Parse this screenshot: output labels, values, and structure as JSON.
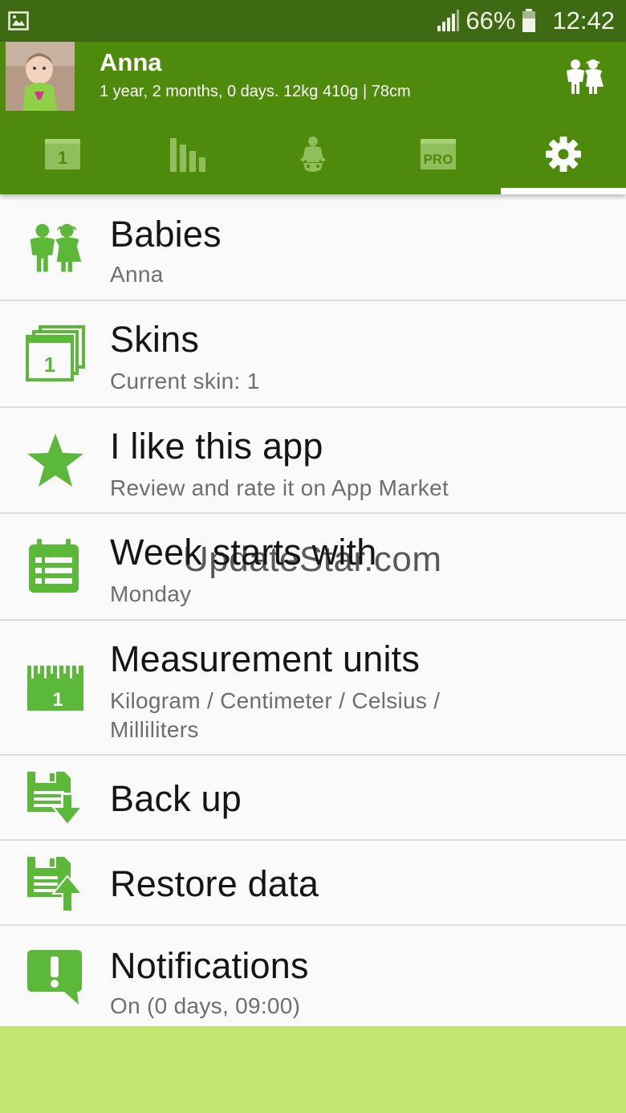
{
  "status_bar": {
    "battery_percent": "66%",
    "time": "12:42",
    "icons": [
      "gallery-notification-icon",
      "signal-icon",
      "battery-icon"
    ]
  },
  "header": {
    "baby_name": "Anna",
    "baby_info": "1 year, 2 months, 0 days. 12kg 410g | 78cm",
    "babies_icon": "children-icon"
  },
  "tabs": [
    {
      "id": "calendar",
      "icon": "calendar-day-icon",
      "number": "1",
      "selected": false
    },
    {
      "id": "charts",
      "icon": "bar-chart-icon",
      "selected": false
    },
    {
      "id": "diaper",
      "icon": "baby-diaper-icon",
      "selected": false
    },
    {
      "id": "pro",
      "icon": "pro-badge-icon",
      "badge": "PRO",
      "selected": false
    },
    {
      "id": "settings",
      "icon": "gear-icon",
      "selected": true
    }
  ],
  "settings": {
    "babies": {
      "title": "Babies",
      "subtitle": "Anna",
      "icon": "children-icon"
    },
    "skins": {
      "title": "Skins",
      "subtitle": "Current skin: 1",
      "icon": "skins-stack-icon",
      "badge": "1"
    },
    "like_app": {
      "title": "I like this app",
      "subtitle": "Review and rate it on App Market",
      "icon": "star-icon"
    },
    "week_start": {
      "title": "Week starts with",
      "subtitle": "Monday",
      "icon": "calendar-list-icon"
    },
    "units": {
      "title": "Measurement units",
      "subtitle": "Kilogram / Centimeter / Celsius / Milliliters",
      "icon": "ruler-icon",
      "badge": "1"
    },
    "backup": {
      "title": "Back up",
      "icon": "save-download-icon"
    },
    "restore": {
      "title": "Restore data",
      "icon": "save-upload-icon"
    },
    "notifications": {
      "title": "Notifications",
      "subtitle": "On (0 days, 09:00)",
      "icon": "alert-bubble-icon"
    }
  },
  "watermark": "UpdateStar.com",
  "colors": {
    "status_bar": "#3f6a14",
    "header": "#4e8a0b",
    "tab_inactive": "#8fbe5a",
    "icon_green": "#5cb838",
    "bottom_bar": "#c3e46f"
  }
}
